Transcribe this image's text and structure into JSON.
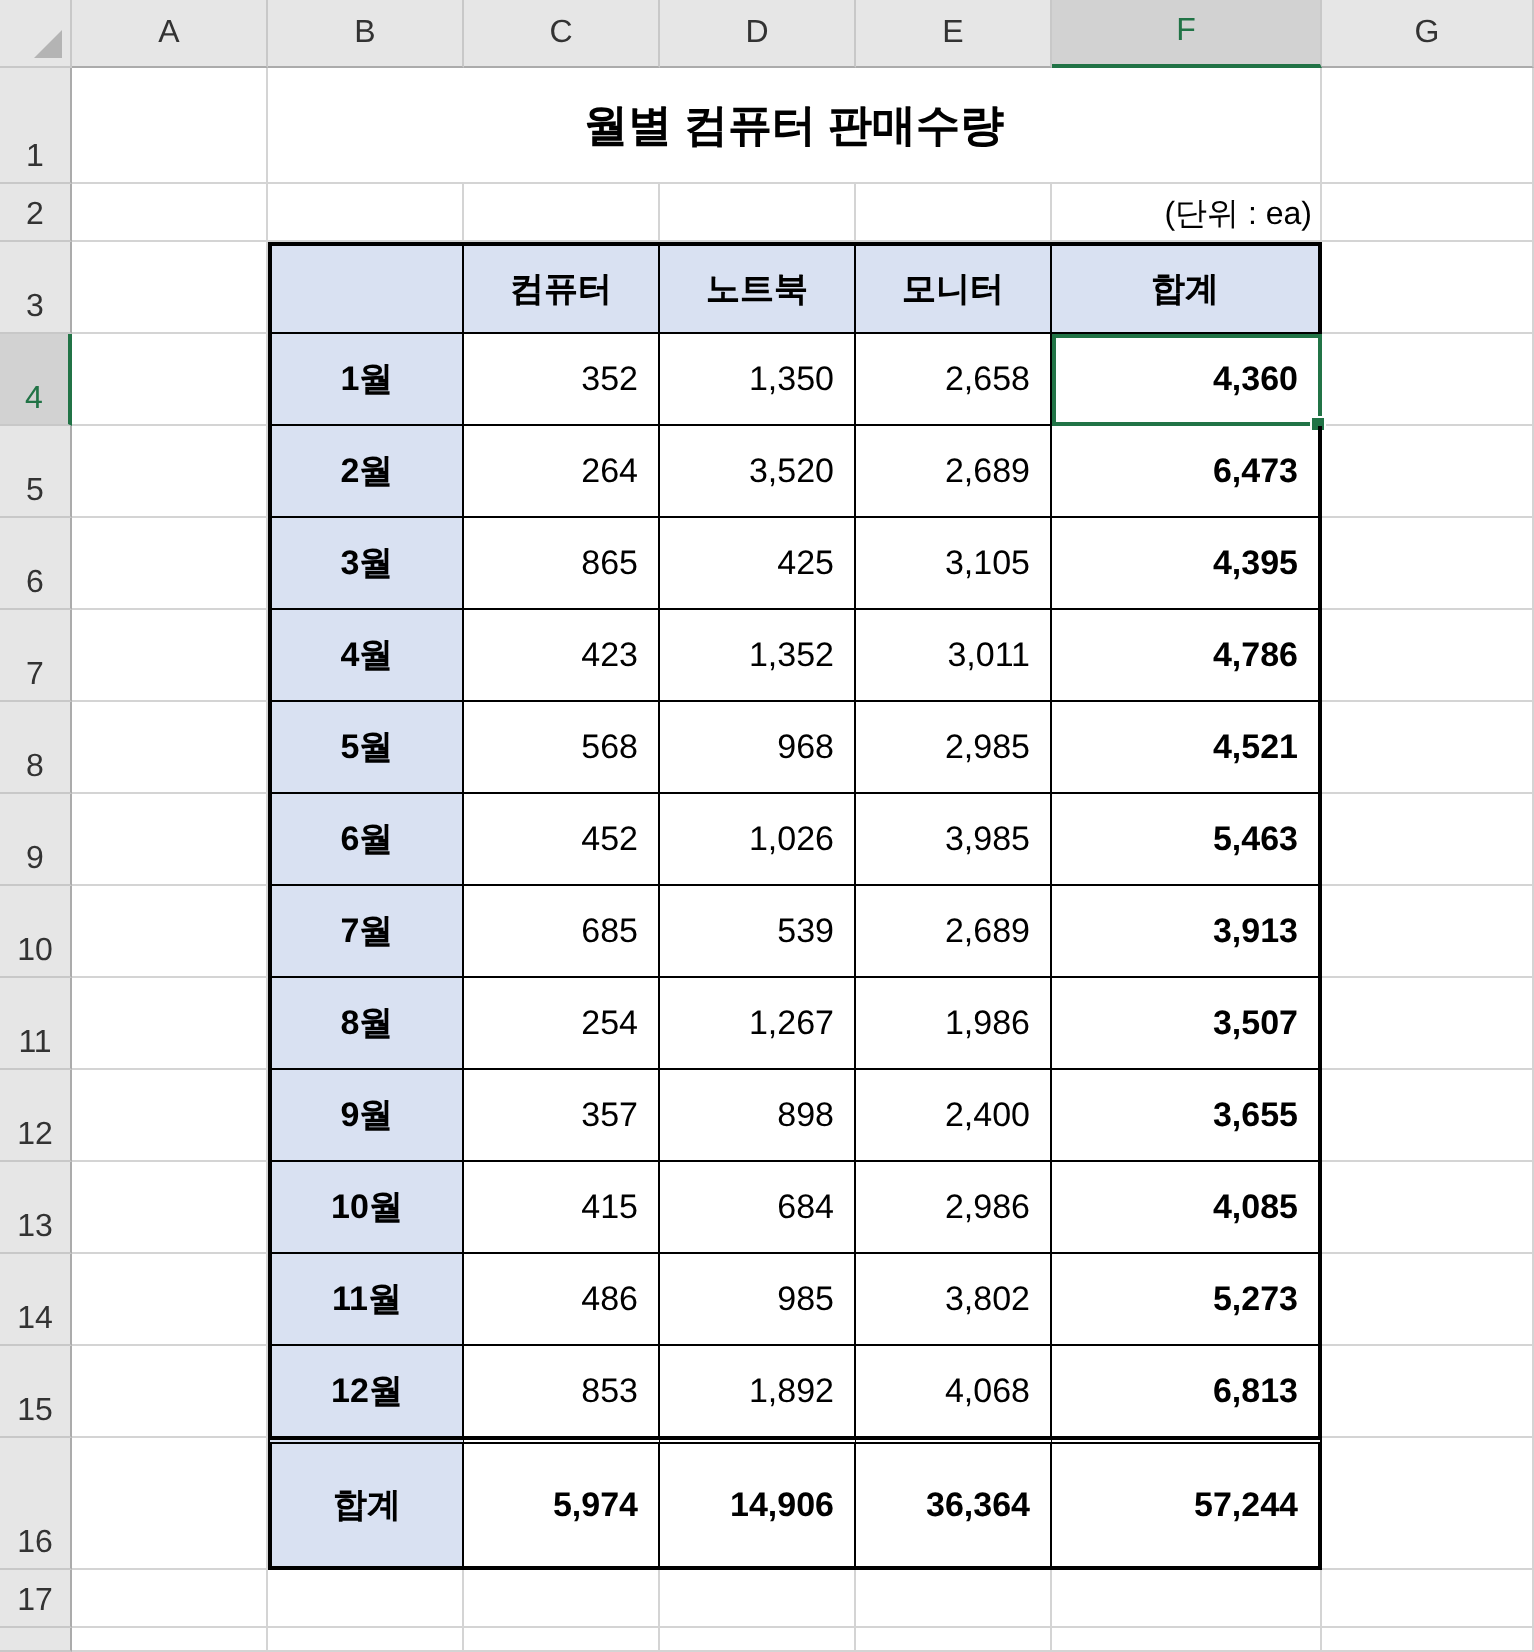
{
  "columns": [
    {
      "label": "A",
      "selected": false
    },
    {
      "label": "B",
      "selected": false
    },
    {
      "label": "C",
      "selected": false
    },
    {
      "label": "D",
      "selected": false
    },
    {
      "label": "E",
      "selected": false
    },
    {
      "label": "F",
      "selected": true
    },
    {
      "label": "G",
      "selected": false
    }
  ],
  "row_numbers": [
    {
      "label": "1",
      "selected": false
    },
    {
      "label": "2",
      "selected": false
    },
    {
      "label": "3",
      "selected": false
    },
    {
      "label": "4",
      "selected": true
    },
    {
      "label": "5",
      "selected": false
    },
    {
      "label": "6",
      "selected": false
    },
    {
      "label": "7",
      "selected": false
    },
    {
      "label": "8",
      "selected": false
    },
    {
      "label": "9",
      "selected": false
    },
    {
      "label": "10",
      "selected": false
    },
    {
      "label": "11",
      "selected": false
    },
    {
      "label": "12",
      "selected": false
    },
    {
      "label": "13",
      "selected": false
    },
    {
      "label": "14",
      "selected": false
    },
    {
      "label": "15",
      "selected": false
    },
    {
      "label": "16",
      "selected": false
    },
    {
      "label": "17",
      "selected": false
    }
  ],
  "title": "월별 컴퓨터 판매수량",
  "unit": "(단위 : ea)",
  "table": {
    "columns": [
      "컴퓨터",
      "노트북",
      "모니터",
      "합계"
    ],
    "rows": [
      {
        "month": "1월",
        "values": [
          "352",
          "1,350",
          "2,658"
        ],
        "total": "4,360",
        "selected": true
      },
      {
        "month": "2월",
        "values": [
          "264",
          "3,520",
          "2,689"
        ],
        "total": "6,473",
        "selected": false
      },
      {
        "month": "3월",
        "values": [
          "865",
          "425",
          "3,105"
        ],
        "total": "4,395",
        "selected": false
      },
      {
        "month": "4월",
        "values": [
          "423",
          "1,352",
          "3,011"
        ],
        "total": "4,786",
        "selected": false
      },
      {
        "month": "5월",
        "values": [
          "568",
          "968",
          "2,985"
        ],
        "total": "4,521",
        "selected": false
      },
      {
        "month": "6월",
        "values": [
          "452",
          "1,026",
          "3,985"
        ],
        "total": "5,463",
        "selected": false
      },
      {
        "month": "7월",
        "values": [
          "685",
          "539",
          "2,689"
        ],
        "total": "3,913",
        "selected": false
      },
      {
        "month": "8월",
        "values": [
          "254",
          "1,267",
          "1,986"
        ],
        "total": "3,507",
        "selected": false
      },
      {
        "month": "9월",
        "values": [
          "357",
          "898",
          "2,400"
        ],
        "total": "3,655",
        "selected": false
      },
      {
        "month": "10월",
        "values": [
          "415",
          "684",
          "2,986"
        ],
        "total": "4,085",
        "selected": false
      },
      {
        "month": "11월",
        "values": [
          "486",
          "985",
          "3,802"
        ],
        "total": "5,273",
        "selected": false
      },
      {
        "month": "12월",
        "values": [
          "853",
          "1,892",
          "4,068"
        ],
        "total": "6,813",
        "selected": false
      }
    ],
    "total_row": {
      "label": "합계",
      "values": [
        "5,974",
        "14,906",
        "36,364"
      ],
      "total": "57,244"
    }
  }
}
